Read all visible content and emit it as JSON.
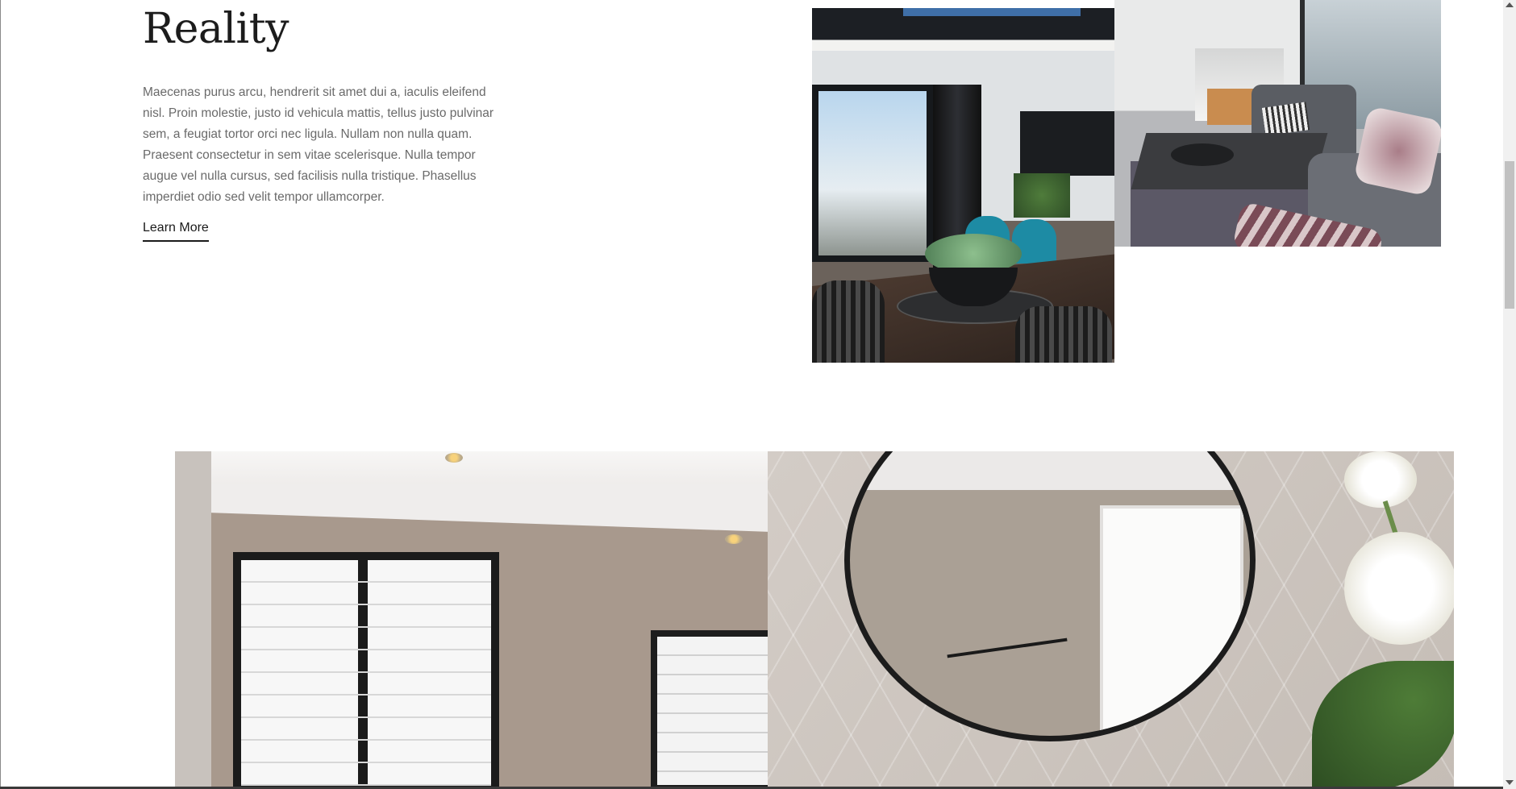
{
  "section": {
    "heading": "Reality",
    "paragraph": "Maecenas purus arcu, hendrerit sit amet dui a, iaculis eleifend nisl. Proin molestie, justo id vehicula mattis, tellus justo pulvinar sem, a feugiat tortor orci nec ligula. Nullam non nulla quam. Praesent consectetur in sem vitae scelerisque. Nulla tempor augue vel nulla cursus, sed facilisis nulla tristique. Phasellus imperdiet odio sed velit tempor ullamcorper.",
    "cta_label": "Learn More"
  },
  "images": {
    "dining": "interior dining area photo",
    "living": "living room and patio photo",
    "bathroom": "bathroom with round mirror photo"
  },
  "icons": {
    "scroll_up": "scroll-up-arrow-icon",
    "scroll_down": "scroll-down-arrow-icon"
  }
}
